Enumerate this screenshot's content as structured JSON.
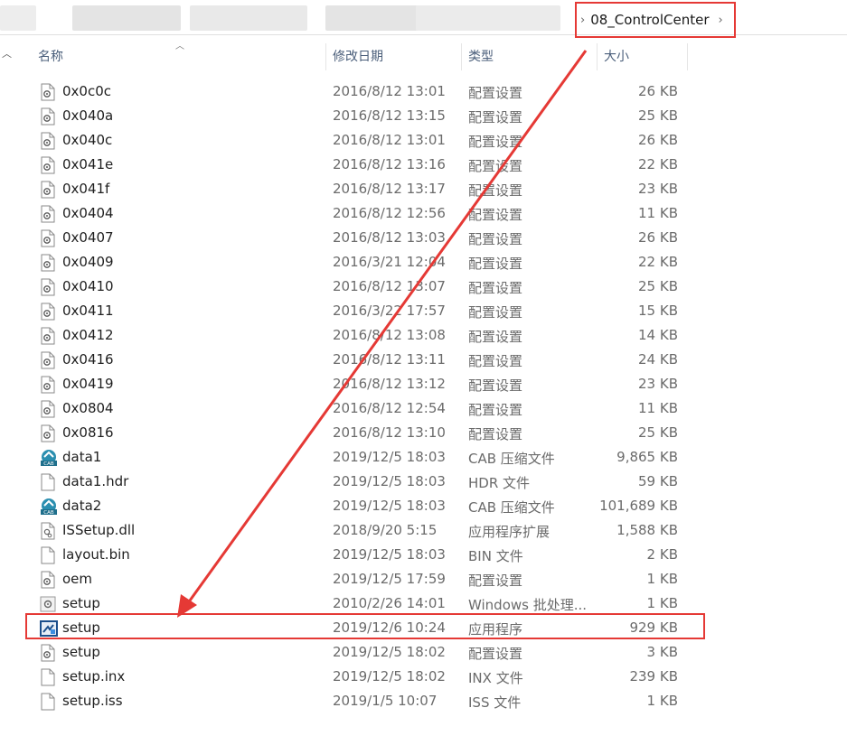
{
  "address": {
    "folder": "08_ControlCenter"
  },
  "columns": {
    "name": "名称",
    "modified": "修改日期",
    "type": "类型",
    "size": "大小"
  },
  "files": [
    {
      "name": "0x0c0c",
      "modified": "2016/8/12 13:01",
      "type": "配置设置",
      "size": "26 KB",
      "icon": "config-file-icon"
    },
    {
      "name": "0x040a",
      "modified": "2016/8/12 13:15",
      "type": "配置设置",
      "size": "25 KB",
      "icon": "config-file-icon"
    },
    {
      "name": "0x040c",
      "modified": "2016/8/12 13:01",
      "type": "配置设置",
      "size": "26 KB",
      "icon": "config-file-icon"
    },
    {
      "name": "0x041e",
      "modified": "2016/8/12 13:16",
      "type": "配置设置",
      "size": "22 KB",
      "icon": "config-file-icon"
    },
    {
      "name": "0x041f",
      "modified": "2016/8/12 13:17",
      "type": "配置设置",
      "size": "23 KB",
      "icon": "config-file-icon"
    },
    {
      "name": "0x0404",
      "modified": "2016/8/12 12:56",
      "type": "配置设置",
      "size": "11 KB",
      "icon": "config-file-icon"
    },
    {
      "name": "0x0407",
      "modified": "2016/8/12 13:03",
      "type": "配置设置",
      "size": "26 KB",
      "icon": "config-file-icon"
    },
    {
      "name": "0x0409",
      "modified": "2016/3/21 12:04",
      "type": "配置设置",
      "size": "22 KB",
      "icon": "config-file-icon"
    },
    {
      "name": "0x0410",
      "modified": "2016/8/12 13:07",
      "type": "配置设置",
      "size": "25 KB",
      "icon": "config-file-icon"
    },
    {
      "name": "0x0411",
      "modified": "2016/3/22 17:57",
      "type": "配置设置",
      "size": "15 KB",
      "icon": "config-file-icon"
    },
    {
      "name": "0x0412",
      "modified": "2016/8/12 13:08",
      "type": "配置设置",
      "size": "14 KB",
      "icon": "config-file-icon"
    },
    {
      "name": "0x0416",
      "modified": "2016/8/12 13:11",
      "type": "配置设置",
      "size": "24 KB",
      "icon": "config-file-icon"
    },
    {
      "name": "0x0419",
      "modified": "2016/8/12 13:12",
      "type": "配置设置",
      "size": "23 KB",
      "icon": "config-file-icon"
    },
    {
      "name": "0x0804",
      "modified": "2016/8/12 12:54",
      "type": "配置设置",
      "size": "11 KB",
      "icon": "config-file-icon"
    },
    {
      "name": "0x0816",
      "modified": "2016/8/12 13:10",
      "type": "配置设置",
      "size": "25 KB",
      "icon": "config-file-icon"
    },
    {
      "name": "data1",
      "modified": "2019/12/5 18:03",
      "type": "CAB 压缩文件",
      "size": "9,865 KB",
      "icon": "cab-archive-icon"
    },
    {
      "name": "data1.hdr",
      "modified": "2019/12/5 18:03",
      "type": "HDR 文件",
      "size": "59 KB",
      "icon": "blank-file-icon"
    },
    {
      "name": "data2",
      "modified": "2019/12/5 18:03",
      "type": "CAB 压缩文件",
      "size": "101,689 KB",
      "icon": "cab-archive-icon"
    },
    {
      "name": "ISSetup.dll",
      "modified": "2018/9/20 5:15",
      "type": "应用程序扩展",
      "size": "1,588 KB",
      "icon": "dll-file-icon"
    },
    {
      "name": "layout.bin",
      "modified": "2019/12/5 18:03",
      "type": "BIN 文件",
      "size": "2 KB",
      "icon": "blank-file-icon"
    },
    {
      "name": "oem",
      "modified": "2019/12/5 17:59",
      "type": "配置设置",
      "size": "1 KB",
      "icon": "config-file-icon"
    },
    {
      "name": "setup",
      "modified": "2010/2/26 14:01",
      "type": "Windows 批处理...",
      "size": "1 KB",
      "icon": "batch-file-icon"
    },
    {
      "name": "setup",
      "modified": "2019/12/6 10:24",
      "type": "应用程序",
      "size": "929 KB",
      "icon": "setup-exe-icon",
      "highlighted": true
    },
    {
      "name": "setup",
      "modified": "2019/12/5 18:02",
      "type": "配置设置",
      "size": "3 KB",
      "icon": "config-file-icon"
    },
    {
      "name": "setup.inx",
      "modified": "2019/12/5 18:02",
      "type": "INX 文件",
      "size": "239 KB",
      "icon": "blank-file-icon"
    },
    {
      "name": "setup.iss",
      "modified": "2019/1/5 10:07",
      "type": "ISS 文件",
      "size": "1 KB",
      "icon": "blank-file-icon"
    }
  ],
  "colors": {
    "annotation_red": "#e53935",
    "header_text": "#4a5e7a",
    "meta_text": "#6b6b6b"
  }
}
